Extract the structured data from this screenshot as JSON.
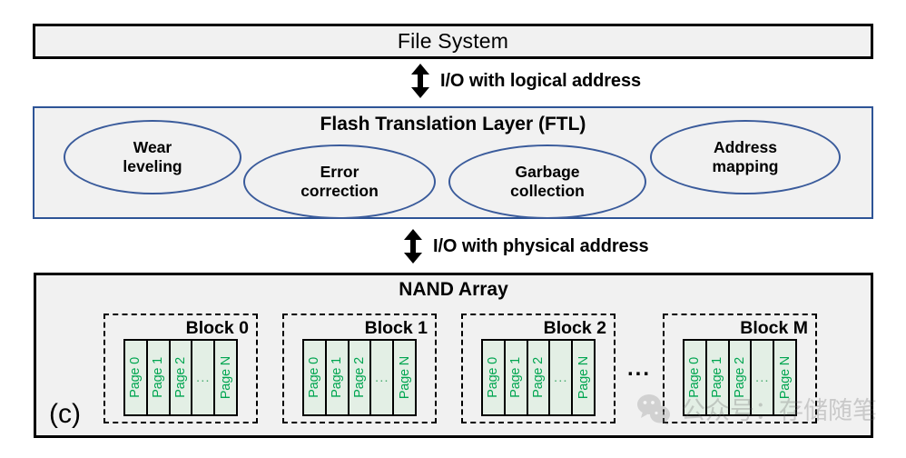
{
  "diagram": {
    "panel_label": "(c)",
    "file_system": {
      "title": "File System"
    },
    "arrows": [
      {
        "icon": "double-arrow-vertical-icon",
        "caption": "I/O with logical address"
      },
      {
        "icon": "double-arrow-vertical-icon",
        "caption": "I/O with physical address"
      }
    ],
    "ftl": {
      "title": "Flash Translation Layer (FTL)",
      "functions": [
        {
          "line1": "Wear",
          "line2": "leveling"
        },
        {
          "line1": "Error",
          "line2": "correction"
        },
        {
          "line1": "Garbage",
          "line2": "collection"
        },
        {
          "line1": "Address",
          "line2": "mapping"
        }
      ]
    },
    "nand": {
      "title": "NAND Array",
      "block_ellipsis": "...",
      "blocks": [
        {
          "title": "Block 0",
          "pages": [
            "Page 0",
            "Page 1",
            "Page 2",
            "...",
            "Page N"
          ]
        },
        {
          "title": "Block 1",
          "pages": [
            "Page 0",
            "Page 1",
            "Page 2",
            "...",
            "Page N"
          ]
        },
        {
          "title": "Block 2",
          "pages": [
            "Page 0",
            "Page 1",
            "Page 2",
            "...",
            "Page N"
          ]
        },
        {
          "title": "Block M",
          "pages": [
            "Page 0",
            "Page 1",
            "Page 2",
            "...",
            "Page N"
          ]
        }
      ]
    },
    "watermark": {
      "icon": "wechat-icon",
      "text": "公众号：存储随笔"
    },
    "colors": {
      "box_fill": "#F1F1F1",
      "ftl_border": "#2E5496",
      "ellipse_border": "#3A5B9B",
      "page_fill": "#E3EFE5",
      "page_text": "#00A550",
      "outline": "#000000"
    }
  }
}
